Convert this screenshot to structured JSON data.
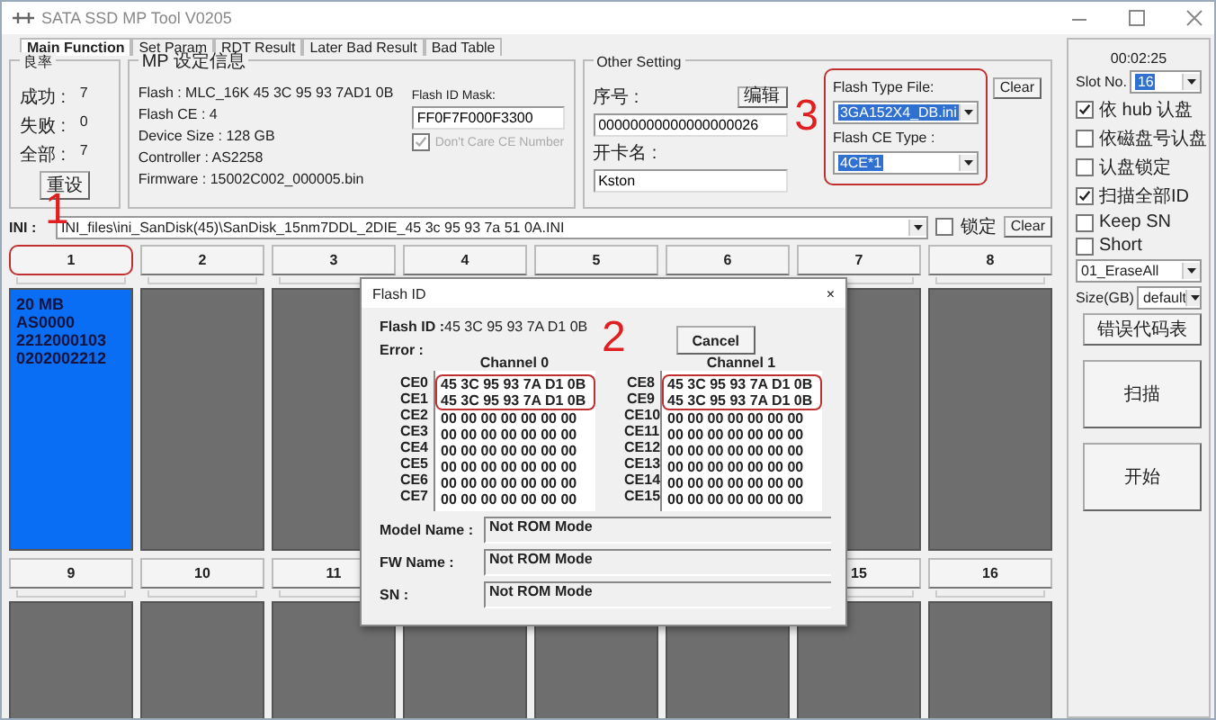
{
  "window": {
    "title": "SATA SSD MP Tool V0205"
  },
  "tabs": [
    {
      "label": "Main Function",
      "selected": true
    },
    {
      "label": "Set Param",
      "selected": false
    },
    {
      "label": "RDT Result",
      "selected": false
    },
    {
      "label": "Later Bad Result",
      "selected": false
    },
    {
      "label": "Bad Table",
      "selected": false
    }
  ],
  "yield": {
    "title": "良率",
    "rows": [
      {
        "label": "成功 :",
        "value": "7"
      },
      {
        "label": "失败 :",
        "value": "0"
      },
      {
        "label": "全部 :",
        "value": "7"
      }
    ],
    "reset_button": "重设"
  },
  "mp_info": {
    "title": "MP 设定信息",
    "lines": [
      "Flash : MLC_16K 45 3C 95 93 7AD1 0B",
      "Flash CE : 4",
      "Device Size : 128 GB",
      "Controller : AS2258",
      "Firmware : 15002C002_000005.bin"
    ],
    "mask_label": "Flash ID Mask:",
    "mask_value": "FF0F7F000F3300",
    "dont_care": {
      "label": "Don't Care CE Number",
      "checked": true,
      "disabled": true
    }
  },
  "other_setting": {
    "title": "Other Setting",
    "serial_label": "序号 :",
    "edit_button": "编辑",
    "serial_value": "00000000000000000026",
    "card_label": "开卡名 :",
    "card_value": "Kston",
    "flash_type_label": "Flash Type File:",
    "flash_type_value": "3GA152X4_DB.ini",
    "clear_button": "Clear",
    "ce_type_label": "Flash CE Type :",
    "ce_type_value": "4CE*1",
    "highlighted": true
  },
  "ini": {
    "label": "INI :",
    "value": "INI_files\\ini_SanDisk(45)\\SanDisk_15nm7DDL_2DIE_45 3c 95 93 7a 51 0A.INI",
    "lock": {
      "label": "锁定",
      "checked": false
    },
    "clear_button": "Clear"
  },
  "slots": [
    {
      "label": "1",
      "selected": true,
      "highlighted": true,
      "lines": [
        "20 MB",
        "AS0000",
        "2212000103",
        "0202002212"
      ]
    },
    {
      "label": "2",
      "selected": false,
      "highlighted": false
    },
    {
      "label": "3",
      "selected": false,
      "highlighted": false
    },
    {
      "label": "4",
      "highlighted": false
    },
    {
      "label": "5",
      "highlighted": false
    },
    {
      "label": "6",
      "highlighted": false
    },
    {
      "label": "7",
      "selected": false,
      "highlighted": false
    },
    {
      "label": "8",
      "selected": false,
      "highlighted": false
    },
    {
      "label": "9",
      "selected": false,
      "highlighted": false
    },
    {
      "label": "10",
      "selected": false,
      "highlighted": false
    },
    {
      "label": "11",
      "selected": false,
      "highlighted": false
    },
    {
      "selected": false
    },
    {
      "selected": false
    },
    {
      "selected": false
    },
    {
      "label": "15",
      "selected": false,
      "highlighted": false
    },
    {
      "label": "16",
      "selected": false,
      "highlighted": false
    }
  ],
  "side": {
    "time": "00:02:25",
    "slot_label": "Slot No.",
    "slot_value": "16",
    "options": [
      {
        "label": "依 hub 认盘",
        "checked": true
      },
      {
        "label": "依磁盘号认盘",
        "checked": false
      },
      {
        "label": "认盘锁定",
        "checked": false
      },
      {
        "label": "扫描全部ID",
        "checked": true
      },
      {
        "label": "Keep SN",
        "checked": false
      },
      {
        "label": "Short",
        "checked": false
      }
    ],
    "mode_value": "01_EraseAll",
    "size_label": "Size(GB)",
    "size_value": "default",
    "error_button": "错误代码表",
    "scan_button": "扫描",
    "start_button": "开始"
  },
  "dialog": {
    "title": "Flash ID",
    "close": "×",
    "flash_id_label": "Flash ID :",
    "flash_id_value": "45 3C 95 93 7A D1 0B",
    "error_label": "Error :",
    "cancel_button": "Cancel",
    "channels": [
      {
        "title": "Channel 0",
        "rows": [
          {
            "ce": "CE0",
            "value": "45 3C 95 93 7A D1 0B",
            "highlighted": true
          },
          {
            "ce": "CE1",
            "value": "45 3C 95 93 7A D1 0B",
            "highlighted": true
          },
          {
            "ce": "CE2",
            "value": "00 00 00 00 00 00 00",
            "highlighted": false
          },
          {
            "ce": "CE3",
            "value": "00 00 00 00 00 00 00",
            "highlighted": false
          },
          {
            "ce": "CE4",
            "value": "00 00 00 00 00 00 00",
            "highlighted": false
          },
          {
            "ce": "CE5",
            "value": "00 00 00 00 00 00 00",
            "highlighted": false
          },
          {
            "ce": "CE6",
            "value": "00 00 00 00 00 00 00",
            "highlighted": false
          },
          {
            "ce": "CE7",
            "value": "00 00 00 00 00 00 00",
            "highlighted": false
          }
        ]
      },
      {
        "title": "Channel 1",
        "rows": [
          {
            "ce": "CE8",
            "value": "45 3C 95 93 7A D1 0B",
            "highlighted": true
          },
          {
            "ce": "CE9",
            "value": "45 3C 95 93 7A D1 0B",
            "highlighted": true
          },
          {
            "ce": "CE10",
            "value": "00 00 00 00 00 00 00",
            "highlighted": false
          },
          {
            "ce": "CE11",
            "value": "00 00 00 00 00 00 00",
            "highlighted": false
          },
          {
            "ce": "CE12",
            "value": "00 00 00 00 00 00 00",
            "highlighted": false
          },
          {
            "ce": "CE13",
            "value": "00 00 00 00 00 00 00",
            "highlighted": false
          },
          {
            "ce": "CE14",
            "value": "00 00 00 00 00 00 00",
            "highlighted": false
          },
          {
            "ce": "CE15",
            "value": "00 00 00 00 00 00 00",
            "highlighted": false
          }
        ]
      }
    ],
    "fields": [
      {
        "label": "Model Name :",
        "value": "Not ROM Mode"
      },
      {
        "label": "FW Name :",
        "value": "Not ROM Mode"
      },
      {
        "label": "SN :",
        "value": "Not ROM Mode"
      }
    ]
  },
  "annotations": [
    {
      "label": "1"
    },
    {
      "label": "2"
    },
    {
      "label": "3"
    }
  ]
}
